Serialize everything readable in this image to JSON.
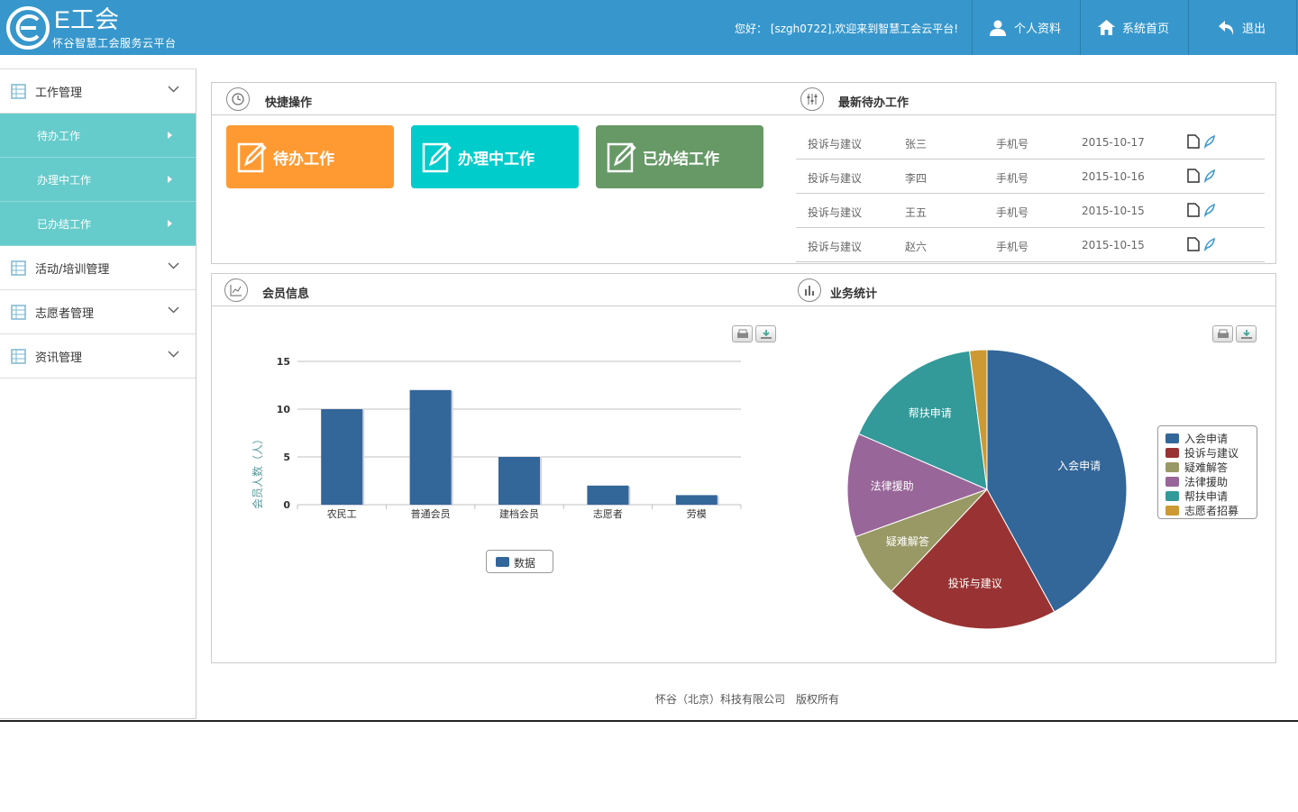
{
  "header": {
    "brand": "E工会",
    "subtitle": "怀谷智慧工会服务云平台",
    "welcome": "您好： [szgh0722],欢迎来到智慧工会云平台!",
    "profile_label": "个人资料",
    "home_label": "系统首页",
    "logout_label": "退出",
    "bg_color": "#3797cc"
  },
  "sidebar": {
    "items": [
      {
        "label": "工作管理",
        "icon": "grid-icon",
        "expanded": true
      },
      {
        "label": "活动/培训管理",
        "icon": "grid-icon"
      },
      {
        "label": "志愿者管理",
        "icon": "grid-icon"
      },
      {
        "label": "资讯管理",
        "icon": "grid-icon"
      }
    ],
    "subitems": [
      {
        "label": "待办工作"
      },
      {
        "label": "办理中工作"
      },
      {
        "label": "已办结工作"
      }
    ],
    "sub_color": "#66cbcb"
  },
  "quick": {
    "title": "快捷操作",
    "buttons": [
      {
        "label": "待办工作",
        "color": "#ff9a33"
      },
      {
        "label": "办理中工作",
        "color": "#00cccc"
      },
      {
        "label": "已办结工作",
        "color": "#669966"
      }
    ]
  },
  "todo": {
    "title": "最新待办工作",
    "rows": [
      {
        "type": "投诉与建议",
        "name": "张三",
        "phone": "手机号",
        "date": "2015-10-17"
      },
      {
        "type": "投诉与建议",
        "name": "李四",
        "phone": "手机号",
        "date": "2015-10-16"
      },
      {
        "type": "投诉与建议",
        "name": "王五",
        "phone": "手机号",
        "date": "2015-10-15"
      },
      {
        "type": "投诉与建议",
        "name": "赵六",
        "phone": "手机号",
        "date": "2015-10-15"
      }
    ]
  },
  "member": {
    "title": "会员信息"
  },
  "business": {
    "title": "业务统计"
  },
  "chart_data": [
    {
      "type": "bar",
      "categories": [
        "农民工",
        "普通会员",
        "建档会员",
        "志愿者",
        "劳模"
      ],
      "series": [
        {
          "name": "数据",
          "values": [
            10,
            12,
            5,
            2,
            1
          ],
          "color": "#336699"
        }
      ],
      "ylabel": "会员人数（人）",
      "ylim": [
        0,
        15
      ],
      "yticks": [
        0,
        5,
        10,
        15
      ],
      "grid": true,
      "legend": "bottom"
    },
    {
      "type": "pie",
      "labels": [
        "入会申请",
        "投诉与建议",
        "疑难解答",
        "法律援助",
        "帮扶申请",
        "志愿者招募"
      ],
      "values": [
        42,
        20,
        7.5,
        12,
        16.5,
        2
      ],
      "colors": [
        "#336699",
        "#993333",
        "#999966",
        "#996699",
        "#339999",
        "#cc9933"
      ],
      "legend": "right"
    }
  ],
  "footer": {
    "company": "怀谷（北京）科技有限公司",
    "rights": "版权所有"
  }
}
